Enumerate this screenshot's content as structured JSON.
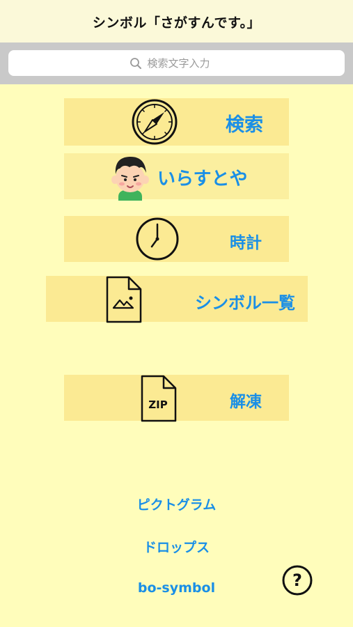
{
  "app": {
    "title": "シンボル「さがすんです。」"
  },
  "search": {
    "placeholder": "検索文字入力",
    "value": ""
  },
  "menu": {
    "search_label": "検索",
    "irasutoya_label": "いらすとや",
    "clock_label": "時計",
    "symbol_list_label": "シンボル一覧",
    "unzip_label": "解凍",
    "zip_icon_text": "ZIP"
  },
  "links": {
    "pictogram": "ピクトグラム",
    "drops": "ドロップス",
    "bo_symbol": "bo-symbol"
  },
  "help": {
    "mark": "?"
  },
  "colors": {
    "background": "#fffdbb",
    "button": "#fbea93",
    "accent": "#1a8fe6"
  }
}
